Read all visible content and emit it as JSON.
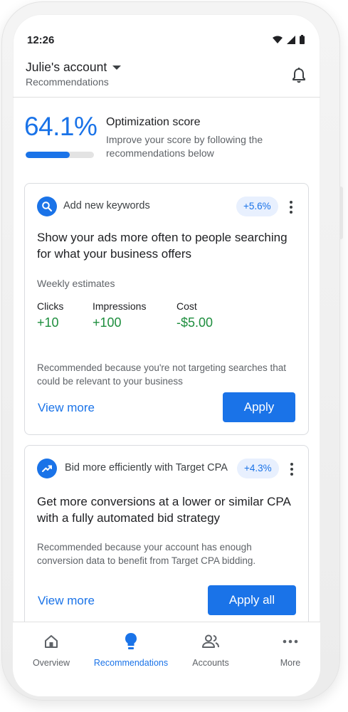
{
  "status_bar": {
    "time": "12:26"
  },
  "header": {
    "account_name": "Julie's account",
    "subtitle": "Recommendations"
  },
  "score": {
    "value_text": "64.1%",
    "fraction": 0.641,
    "title": "Optimization score",
    "description": "Improve your score by following the recommendations below"
  },
  "cards": [
    {
      "icon": "search-icon",
      "label": "Add new keywords",
      "uplift": "+5.6%",
      "headline": "Show your ads more often to people searching for what your business offers",
      "weekly_label": "Weekly estimates",
      "metrics": [
        {
          "label": "Clicks",
          "value": "+10"
        },
        {
          "label": "Impressions",
          "value": "+100"
        },
        {
          "label": "Cost",
          "value": "-$5.00"
        }
      ],
      "reason": "Recommended because you're not targeting searches that could be relevant to your business",
      "view_more": "View more",
      "action": "Apply"
    },
    {
      "icon": "trending-up-icon",
      "label": "Bid more efficiently with Target CPA",
      "uplift": "+4.3%",
      "headline": "Get more conversions at a lower or similar CPA with a fully automated bid strategy",
      "reason": "Recommended because your account has enough conversion data to benefit from Target CPA bidding.",
      "view_more": "View more",
      "action": "Apply all"
    }
  ],
  "bottom_nav": {
    "items": [
      {
        "label": "Overview",
        "icon": "home-icon",
        "active": false
      },
      {
        "label": "Recommendations",
        "icon": "lightbulb-icon",
        "active": true
      },
      {
        "label": "Accounts",
        "icon": "accounts-icon",
        "active": false
      },
      {
        "label": "More",
        "icon": "more-horiz-icon",
        "active": false
      }
    ]
  },
  "colors": {
    "accent": "#1a73e8",
    "positive": "#1e8e3e",
    "chip_bg": "#e8f0fe"
  }
}
